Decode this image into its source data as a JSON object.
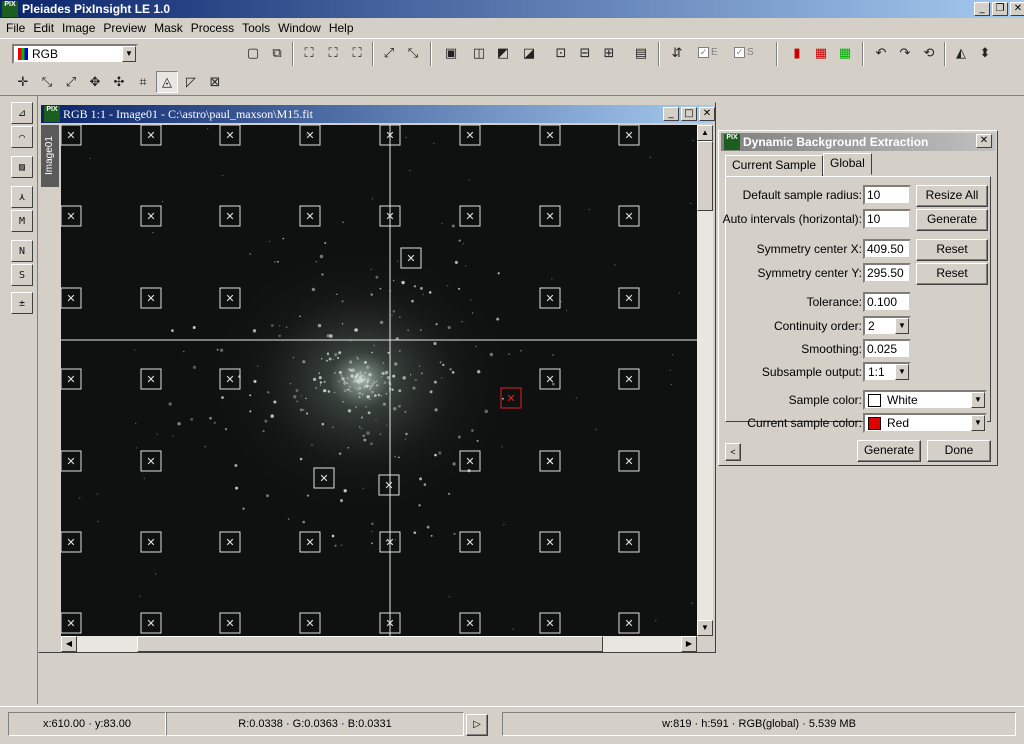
{
  "app": {
    "title": "Pleiades PixInsight LE 1.0",
    "logo": "PIX"
  },
  "caption_buttons": [
    "_",
    "❐",
    "✕"
  ],
  "menu": [
    "File",
    "Edit",
    "Image",
    "Preview",
    "Mask",
    "Process",
    "Tools",
    "Window",
    "Help"
  ],
  "toolbar": {
    "color_mode": "RGB",
    "check_e": "E",
    "check_s": "S"
  },
  "image_window": {
    "title": "RGB 1:1 - Image01 - C:\\astro\\paul_maxson\\M15.fit",
    "side_tab": "Image01",
    "sample_box_glyph": "✕"
  },
  "dbe": {
    "title": "Dynamic Background Extraction",
    "tabs": [
      "Current Sample",
      "Global"
    ],
    "default_sample_radius_label": "Default sample radius:",
    "default_sample_radius": "10",
    "resize_all": "Resize All",
    "auto_intervals_label": "Auto intervals (horizontal):",
    "auto_intervals": "10",
    "generate_top": "Generate",
    "sym_x_label": "Symmetry center X:",
    "sym_x": "409.50",
    "sym_y_label": "Symmetry center Y:",
    "sym_y": "295.50",
    "reset": "Reset",
    "tolerance_label": "Tolerance:",
    "tolerance": "0.100",
    "continuity_label": "Continuity order:",
    "continuity": "2",
    "smoothing_label": "Smoothing:",
    "smoothing": "0.025",
    "subsample_label": "Subsample output:",
    "subsample": "1:1",
    "sample_color_label": "Sample color:",
    "sample_color": "White",
    "current_sample_color_label": "Current sample color:",
    "current_sample_color": "Red",
    "generate": "Generate",
    "done": "Done"
  },
  "status": {
    "coords": "x:610.00 · y:83.00",
    "rgb": "R:0.0338 · G:0.0363 · B:0.0331",
    "info": "w:819 · h:591 · RGB(global) · 5.539 MB"
  },
  "colors": {
    "sample_box": "#e0e0e0",
    "current_sample_box": "#e02020",
    "titlebar": "#0a246a"
  }
}
